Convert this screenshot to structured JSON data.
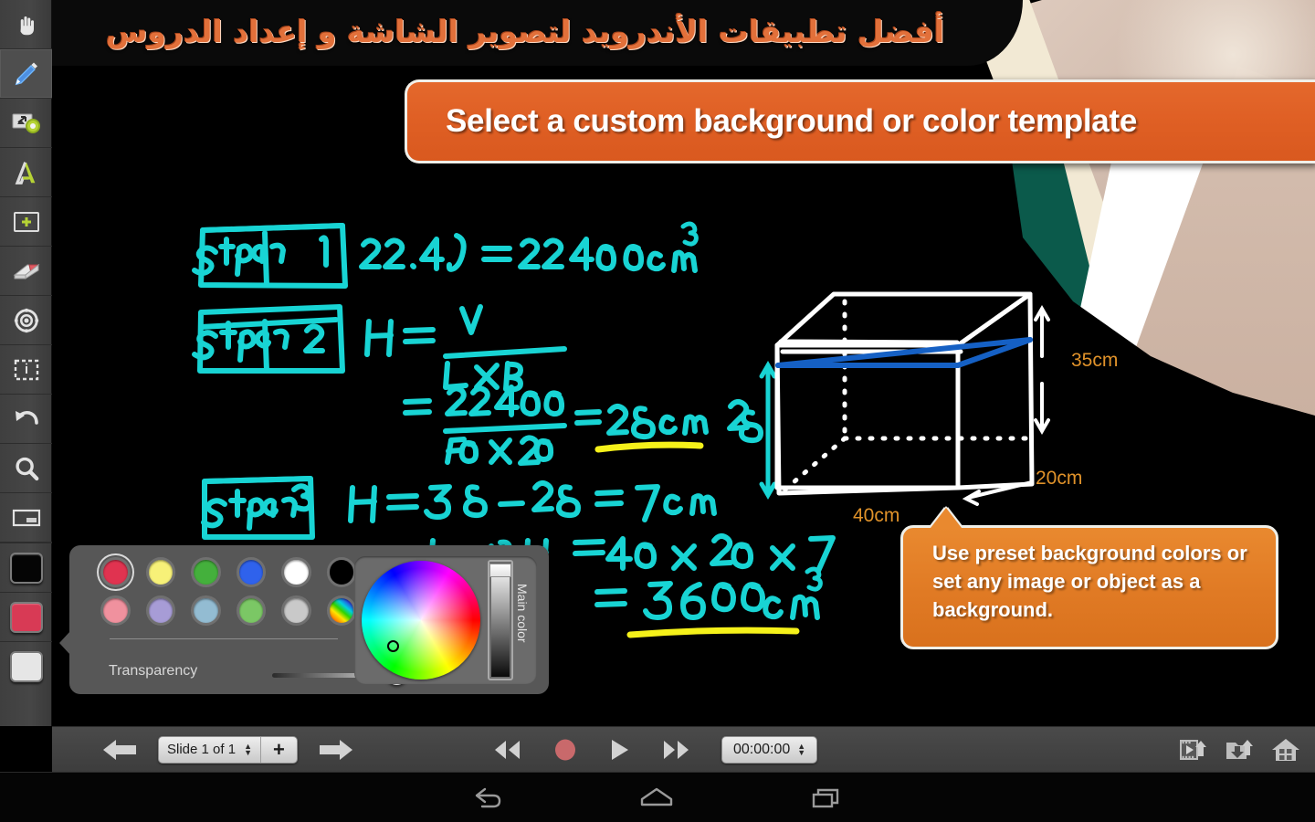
{
  "header": {
    "arabic_title": "أفضل تطبيقات الأندرويد لتصوير الشاشة و إعداد الدروس",
    "headline_banner": "Select a custom background or color template"
  },
  "callout": {
    "text": "Use preset background colors or set any image or object as a background."
  },
  "sidebar": {
    "items": [
      {
        "id": "hand",
        "icon": "hand-icon",
        "label": "Pan / Hand",
        "selected": false
      },
      {
        "id": "pen",
        "icon": "pen-icon",
        "label": "Pen",
        "selected": true
      },
      {
        "id": "image",
        "icon": "image-shape-icon",
        "label": "Insert image",
        "selected": false
      },
      {
        "id": "text",
        "icon": "text-a-icon",
        "label": "Text",
        "selected": false
      },
      {
        "id": "add-frame",
        "icon": "add-frame-icon",
        "label": "Add frame",
        "selected": false
      },
      {
        "id": "eraser",
        "icon": "eraser-icon",
        "label": "Eraser",
        "selected": false
      },
      {
        "id": "laser",
        "icon": "laser-pointer-icon",
        "label": "Laser pointer",
        "selected": false
      },
      {
        "id": "select",
        "icon": "marquee-select-icon",
        "label": "Select",
        "selected": false
      },
      {
        "id": "undo",
        "icon": "undo-arrow-icon",
        "label": "Undo",
        "selected": false
      },
      {
        "id": "zoom",
        "icon": "magnifier-icon",
        "label": "Zoom",
        "selected": false
      },
      {
        "id": "background",
        "icon": "background-icon",
        "label": "Background",
        "selected": false
      }
    ],
    "swatches": [
      {
        "id": "black",
        "color": "#050505",
        "label": "Black swatch"
      },
      {
        "id": "red",
        "color": "#d83a55",
        "label": "Red swatch"
      },
      {
        "id": "white",
        "color": "#e6e6e6",
        "label": "White swatch"
      }
    ]
  },
  "color_picker": {
    "main_color_label": "Main color",
    "transparency_label": "Transparency",
    "transparency_value": 100,
    "preset_rows": [
      [
        {
          "name": "crimson",
          "color": "#e03350",
          "active": true
        },
        {
          "name": "pale-yellow",
          "color": "#f7f178",
          "active": false
        },
        {
          "name": "green",
          "color": "#44b03c",
          "active": false
        },
        {
          "name": "blue",
          "color": "#2f62ec",
          "active": false
        },
        {
          "name": "white",
          "color": "#ffffff",
          "active": false
        },
        {
          "name": "black",
          "color": "#000000",
          "active": false
        }
      ],
      [
        {
          "name": "pink",
          "color": "#f0919e",
          "active": false
        },
        {
          "name": "lavender",
          "color": "#a79cd6",
          "active": false
        },
        {
          "name": "sky",
          "color": "#93bcd2",
          "active": false
        },
        {
          "name": "light-green",
          "color": "#7bc765",
          "active": false
        },
        {
          "name": "grey",
          "color": "#c9c9c9",
          "active": false
        },
        {
          "name": "rainbow",
          "color": "rainbow",
          "active": false
        }
      ]
    ]
  },
  "bottom_toolbar": {
    "prev_slide_label": "Previous slide",
    "next_slide_label": "Next slide",
    "slide_counter": "Slide 1 of 1",
    "add_slide_label": "+",
    "rewind_label": "Rewind",
    "record_label": "Record",
    "play_label": "Play",
    "fast_forward_label": "Fast forward",
    "timer": "00:00:00",
    "export_video_label": "Export video",
    "save_project_label": "Save project",
    "home_label": "Home"
  },
  "navbar": {
    "back_label": "Back",
    "home_label": "Home",
    "recents_label": "Recent apps"
  },
  "whiteboard": {
    "ink_color": "#18d4d4",
    "highlight_color": "#f5f11a",
    "box_edge_color": "#ffffff",
    "box_water_color": "#1560c4",
    "dimension_color": "#e0922a",
    "steps": [
      {
        "tag": "Step 1",
        "line": "22.4 l = 22400 cm³"
      },
      {
        "tag": "Step 2",
        "line": "H = V / (L x B)  = 22400 / (40 x 20) = 28 cm"
      },
      {
        "tag": "Step 3",
        "line": "H = 35 - 28 = 7 cm ;  L x B x H = 40 x 20 x 7 = 5600 cm³"
      }
    ],
    "labels": {
      "height_total": "35cm",
      "depth": "20cm",
      "width": "40cm",
      "water_height": "28"
    }
  }
}
